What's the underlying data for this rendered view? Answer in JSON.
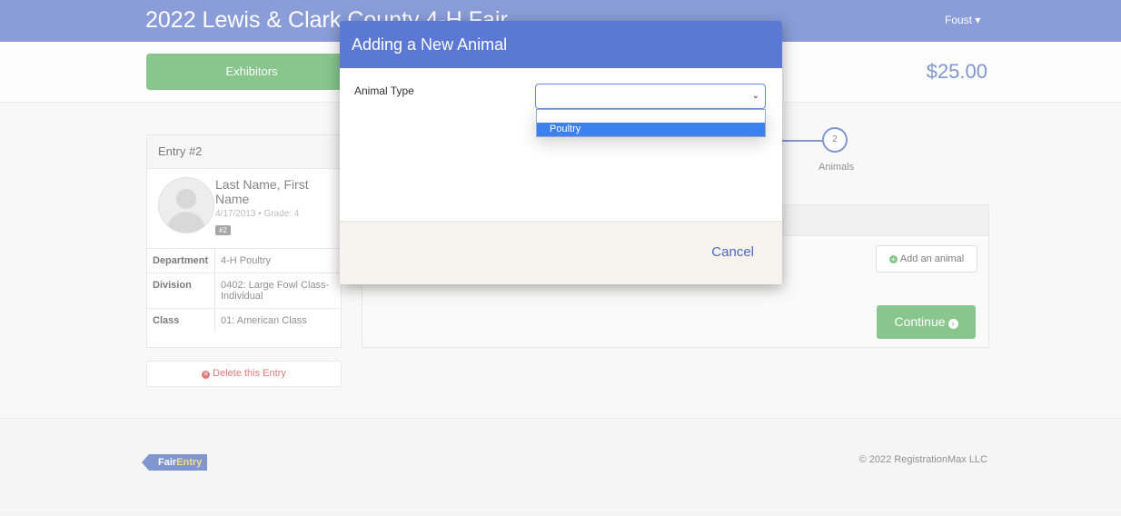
{
  "header": {
    "fair_title": "2022 Lewis & Clark County 4-H Fair",
    "user_menu": "Foust ▾"
  },
  "toolbar": {
    "exhibitors_button": "Exhibitors",
    "total": "$25.00"
  },
  "entry": {
    "title": "Entry #2",
    "exhibitor_name": "Last Name, First Name",
    "dob_grade": "4/17/2013 • Grade: 4",
    "badge": "#2",
    "rows": [
      {
        "label": "Department",
        "value": "4-H Poultry"
      },
      {
        "label": "Division",
        "value": "0402: Large Fowl Class-Individual"
      },
      {
        "label": "Class",
        "value": "01: American Class"
      }
    ],
    "delete_button": "Delete this Entry"
  },
  "steps": {
    "current_number": "2",
    "current_label": "Animals"
  },
  "animals": {
    "add_button": "Add an animal",
    "continue_button": "Continue"
  },
  "footer": {
    "logo_part1": "Fair",
    "logo_part2": "Entry",
    "copyright": "© 2022 RegistrationMax LLC"
  },
  "modal": {
    "title": "Adding a New Animal",
    "field_label": "Animal Type",
    "select_value": "",
    "options": [
      "",
      "Poultry"
    ],
    "highlighted_option": "Poultry",
    "cancel_link": "Cancel"
  },
  "colors": {
    "brand_blue": "#4c69c4",
    "modal_header": "#5a78d4",
    "success_green": "#49a852",
    "option_highlight": "#3b82f0"
  }
}
